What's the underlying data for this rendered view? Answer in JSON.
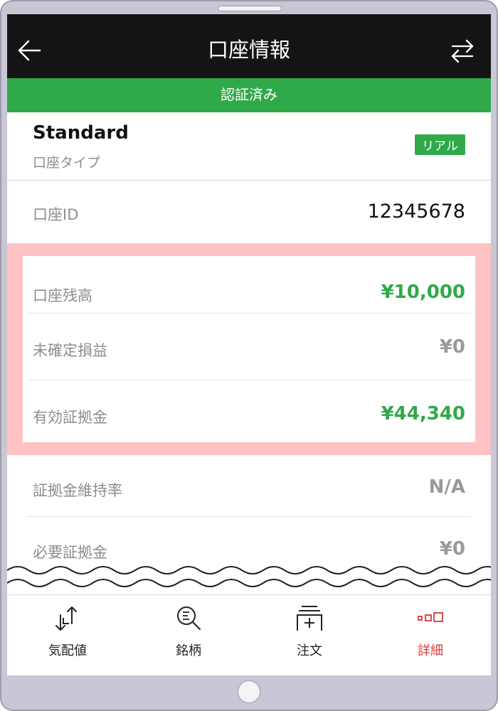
{
  "header": {
    "title": "口座情報"
  },
  "status_bar": {
    "text": "認証済み"
  },
  "account": {
    "type_name": "Standard",
    "type_label": "口座タイプ",
    "badge": "リアル",
    "id_label": "口座ID",
    "id_value": "12345678"
  },
  "highlighted": [
    {
      "label": "口座残高",
      "value": "¥10,000",
      "color": "#30a94a"
    },
    {
      "label": "未確定損益",
      "value": "¥0",
      "color": "#9a9a9a"
    },
    {
      "label": "有効証拠金",
      "value": "¥44,340",
      "color": "#30a94a"
    }
  ],
  "rows": [
    {
      "label": "証拠金維持率",
      "value": "N/A"
    },
    {
      "label": "必要証拠金",
      "value": "¥0"
    }
  ],
  "tabs": [
    {
      "label": "気配値",
      "icon": "quotes-icon"
    },
    {
      "label": "銘柄",
      "icon": "symbol-search-icon"
    },
    {
      "label": "注文",
      "icon": "order-icon"
    },
    {
      "label": "詳細",
      "icon": "details-icon",
      "active": true
    }
  ],
  "colors": {
    "accent_green": "#30a94a",
    "appbar": "#141414",
    "active_tab": "#d23b3b",
    "highlight": "#ffc3c3"
  }
}
